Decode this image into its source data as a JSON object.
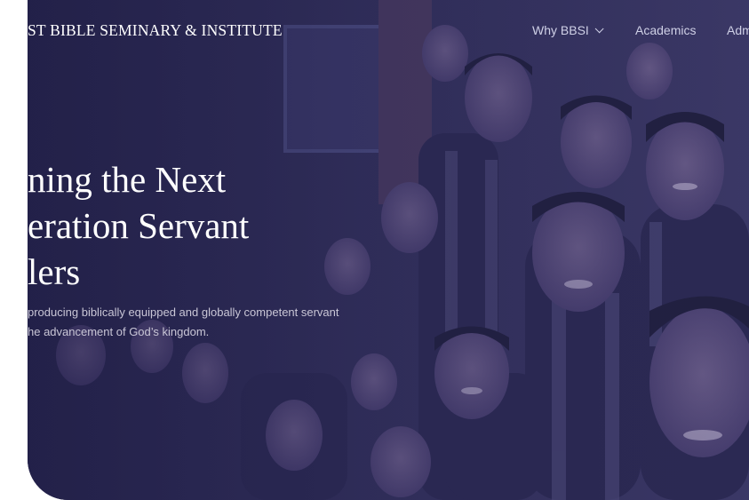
{
  "brand": {
    "name": "ST BIBLE SEMINARY & INSTITUTE"
  },
  "nav": {
    "items": [
      {
        "label": "Why BBSI",
        "has_dropdown": true
      },
      {
        "label": "Academics",
        "has_dropdown": false
      },
      {
        "label": "Admissio",
        "has_dropdown": false
      }
    ]
  },
  "hero": {
    "headline_lines": [
      "ning the Next",
      "eration Servant",
      "lers"
    ],
    "subtext_lines": [
      "producing biblically equipped and globally competent servant",
      "he advancement of God’s kingdom."
    ]
  },
  "colors": {
    "overlay": "#2f2d55",
    "headline": "#ffffff",
    "nav_text": "#cfd0e6",
    "subtext": "#c9c6d6"
  },
  "icons": {
    "dropdown": "chevron-down-icon"
  }
}
